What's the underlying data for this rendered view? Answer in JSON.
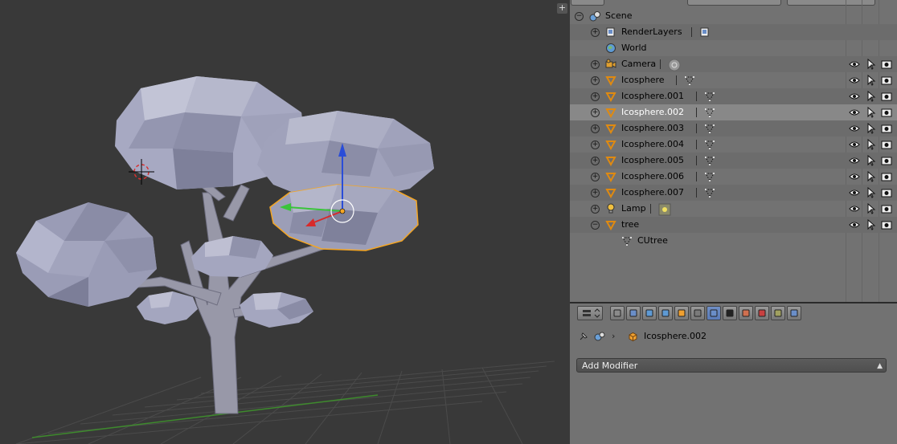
{
  "outliner": {
    "rows": [
      {
        "label": "Scene",
        "icon": "scene-icon",
        "expand": "−"
      },
      {
        "label": "RenderLayers",
        "icon": "renderlayers-icon",
        "expand": "+",
        "data_icon": "renderlayer-data-icon"
      },
      {
        "label": "World",
        "icon": "world-icon",
        "expand": ""
      },
      {
        "label": "Camera",
        "icon": "camera-object-icon",
        "expand": "+",
        "data_icon": "camera-data-icon",
        "vis": true
      },
      {
        "label": "Icosphere",
        "icon": "mesh-object-icon",
        "expand": "+",
        "data_icon": "mesh-data-icon",
        "vis": true
      },
      {
        "label": "Icosphere.001",
        "icon": "mesh-object-icon",
        "expand": "+",
        "data_icon": "mesh-data-icon",
        "vis": true
      },
      {
        "label": "Icosphere.002",
        "icon": "mesh-object-icon",
        "expand": "+",
        "data_icon": "mesh-data-icon",
        "vis": true,
        "active": true
      },
      {
        "label": "Icosphere.003",
        "icon": "mesh-object-icon",
        "expand": "+",
        "data_icon": "mesh-data-icon",
        "vis": true
      },
      {
        "label": "Icosphere.004",
        "icon": "mesh-object-icon",
        "expand": "+",
        "data_icon": "mesh-data-icon",
        "vis": true
      },
      {
        "label": "Icosphere.005",
        "icon": "mesh-object-icon",
        "expand": "+",
        "data_icon": "mesh-data-icon",
        "vis": true
      },
      {
        "label": "Icosphere.006",
        "icon": "mesh-object-icon",
        "expand": "+",
        "data_icon": "mesh-data-icon",
        "vis": true
      },
      {
        "label": "Icosphere.007",
        "icon": "mesh-object-icon",
        "expand": "+",
        "data_icon": "mesh-data-icon",
        "vis": true
      },
      {
        "label": "Lamp",
        "icon": "lamp-object-icon",
        "expand": "+",
        "data_icon": "lamp-data-icon",
        "vis": true
      },
      {
        "label": "tree",
        "icon": "mesh-object-icon",
        "expand": "−",
        "vis": true
      },
      {
        "label": "CUtree",
        "icon": "mesh-data-icon",
        "expand": ""
      }
    ]
  },
  "properties": {
    "breadcrumb_object": "Icosphere.002",
    "add_modifier_label": "Add Modifier",
    "tabs": [
      "render-tab",
      "render-layers-tab",
      "scene-tab",
      "world-tab",
      "object-tab",
      "constraints-tab",
      "modifiers-tab",
      "data-tab",
      "material-tab",
      "texture-tab",
      "particles-tab",
      "physics-tab"
    ],
    "active_tab": "modifiers-tab"
  },
  "colors": {
    "viewport_bg": "#393939",
    "selection_outline": "#f5a623",
    "mesh_face": "#9a9cb8"
  }
}
